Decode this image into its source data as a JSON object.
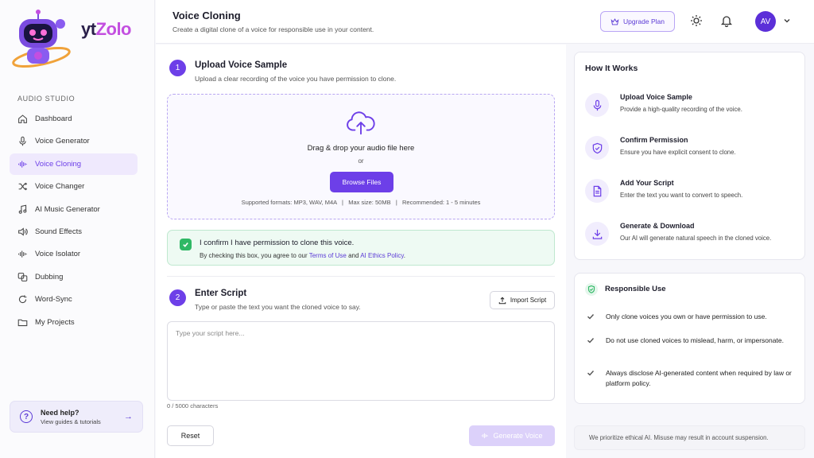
{
  "brand": {
    "name_prefix": "yt",
    "name_suffix": "Zolo"
  },
  "sidebar": {
    "section_label": "AUDIO STUDIO",
    "items": [
      {
        "label": "Dashboard",
        "icon": "home-icon"
      },
      {
        "label": "Voice Generator",
        "icon": "microphone-icon"
      },
      {
        "label": "Voice Cloning",
        "icon": "waveform-icon",
        "active": true
      },
      {
        "label": "Voice Changer",
        "icon": "shuffle-icon"
      },
      {
        "label": "AI Music Generator",
        "icon": "music-note-icon"
      },
      {
        "label": "Sound Effects",
        "icon": "speaker-icon"
      },
      {
        "label": "Voice Isolator",
        "icon": "waveform-icon"
      },
      {
        "label": "Dubbing",
        "icon": "translate-icon"
      },
      {
        "label": "Word-Sync",
        "icon": "sync-icon"
      },
      {
        "label": "My Projects",
        "icon": "folder-icon"
      }
    ],
    "help": {
      "title": "Need help?",
      "subtitle": "View guides & tutorials"
    }
  },
  "header": {
    "title": "Voice Cloning",
    "subtitle": "Create a digital clone of a voice for responsible use in your content.",
    "upgrade_label": "Upgrade Plan",
    "avatar_initials": "AV"
  },
  "step1": {
    "number": "1",
    "title": "Upload Voice Sample",
    "subtitle": "Upload a clear recording of the voice you have permission to clone.",
    "drop_title": "Drag & drop your audio file here",
    "or": "or",
    "browse_label": "Browse Files",
    "formats": "Supported formats: MP3, WAV, M4A   |   Max size: 50MB   |   Recommended: 1 - 5 minutes"
  },
  "confirm": {
    "title": "I confirm I have permission to clone this voice.",
    "sub_prefix": "By checking this box, you agree to our ",
    "terms": "Terms of Use",
    "and": " and ",
    "ethics": "AI Ethics Policy",
    "period": ".",
    "checked": true
  },
  "step2": {
    "number": "2",
    "title": "Enter Script",
    "subtitle": "Type or paste the text you want the cloned voice to say.",
    "import_label": "Import Script",
    "placeholder": "Type your script here...",
    "char_count": "0 / 5000 characters",
    "reset_label": "Reset",
    "generate_label": "Generate Voice"
  },
  "how": {
    "title": "How It Works",
    "items": [
      {
        "title": "Upload Voice Sample",
        "desc": "Provide a high-quality recording of the voice.",
        "icon": "microphone-icon"
      },
      {
        "title": "Confirm Permission",
        "desc": "Ensure you have explicit consent to clone.",
        "icon": "shield-check-icon"
      },
      {
        "title": "Add Your Script",
        "desc": "Enter the text you want to convert to speech.",
        "icon": "document-icon"
      },
      {
        "title": "Generate & Download",
        "desc": "Our AI will generate natural speech in the cloned voice.",
        "icon": "download-icon"
      }
    ]
  },
  "responsible": {
    "title": "Responsible Use",
    "items": [
      "Only clone voices you own or have permission to use.",
      "Do not use cloned voices to mislead, harm, or impersonate.",
      "Always disclose AI-generated content when required by law or platform policy."
    ]
  },
  "footer_note": "We prioritize ethical AI. Misuse may result in account suspension.",
  "colors": {
    "accent": "#6d3fe8",
    "success": "#2fb865",
    "brand_pink": "#c34fe0"
  }
}
